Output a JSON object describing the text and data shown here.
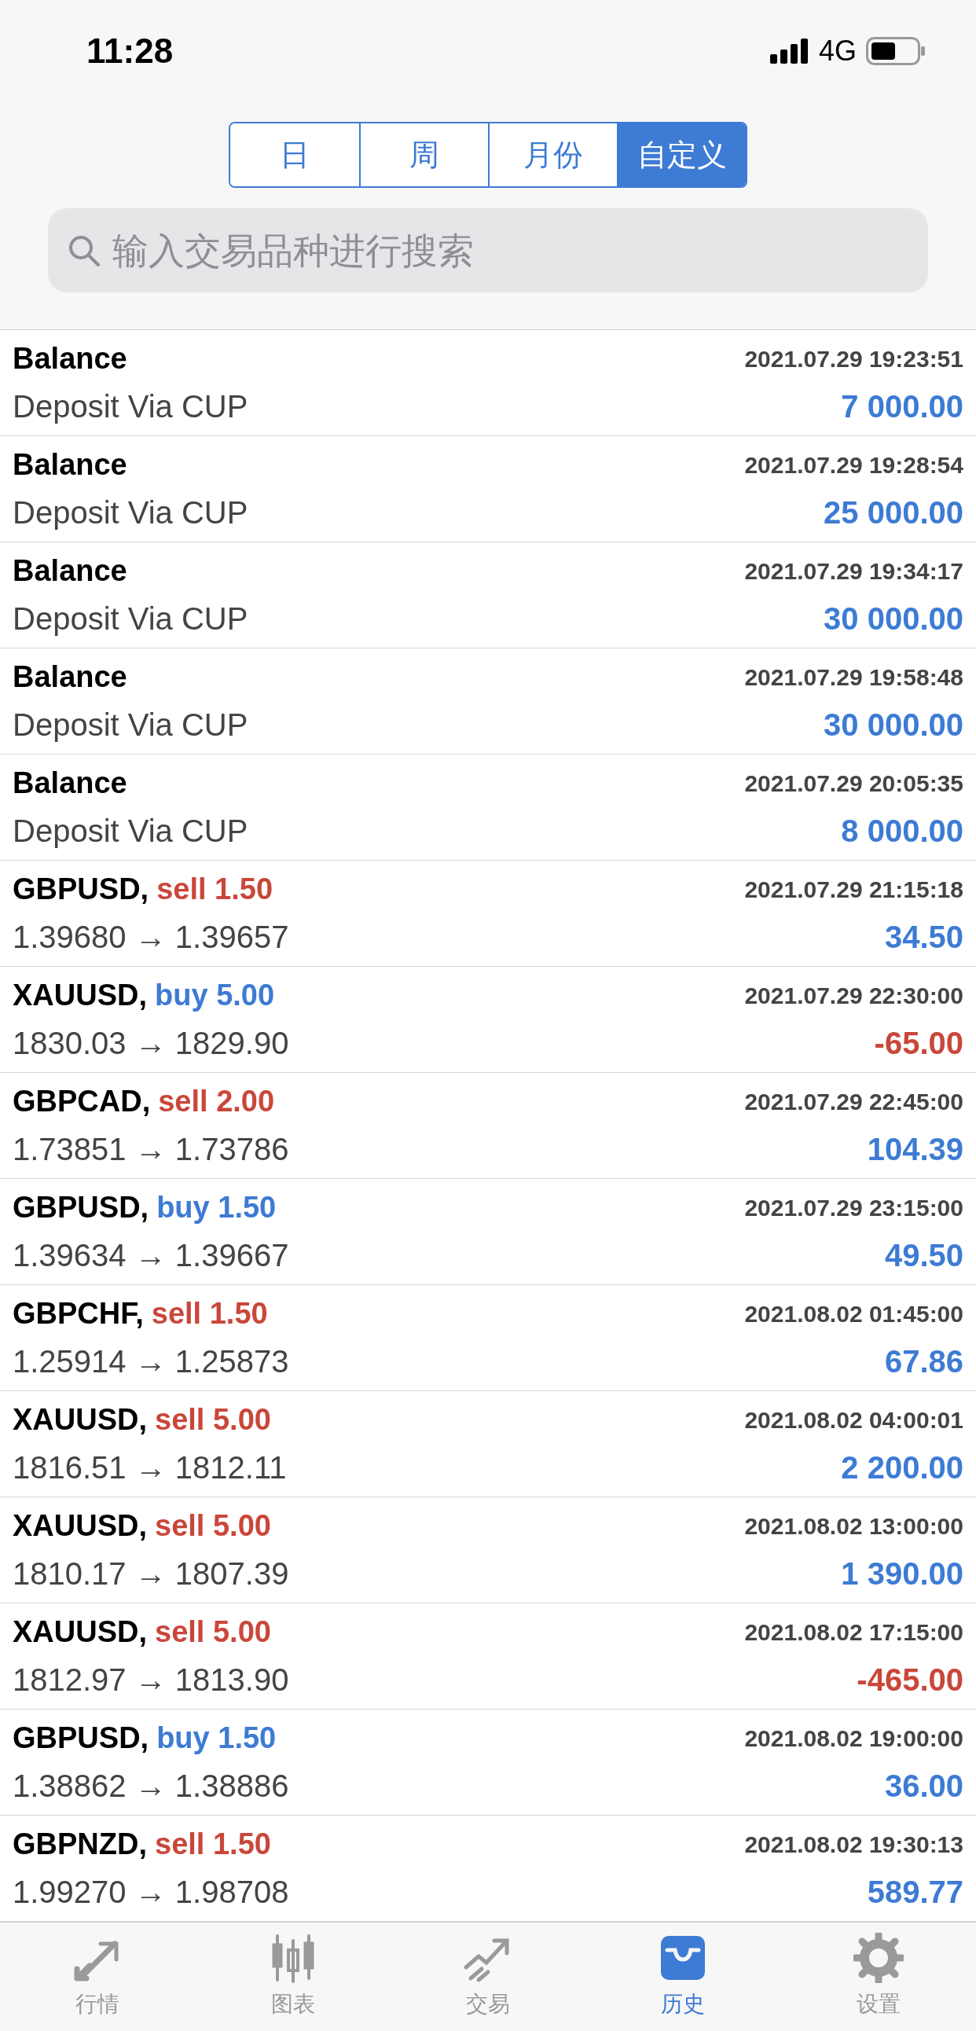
{
  "status_bar": {
    "time": "11:28",
    "network": "4G"
  },
  "periods": [
    {
      "label": "日",
      "selected": false
    },
    {
      "label": "周",
      "selected": false
    },
    {
      "label": "月份",
      "selected": false
    },
    {
      "label": "自定义",
      "selected": true
    }
  ],
  "search": {
    "placeholder": "输入交易品种进行搜索"
  },
  "history": [
    {
      "kind": "balance",
      "title": "Balance",
      "time": "2021.07.29 19:23:51",
      "comment": "Deposit Via CUP",
      "amount": "7 000.00",
      "loss": false
    },
    {
      "kind": "balance",
      "title": "Balance",
      "time": "2021.07.29 19:28:54",
      "comment": "Deposit Via CUP",
      "amount": "25 000.00",
      "loss": false
    },
    {
      "kind": "balance",
      "title": "Balance",
      "time": "2021.07.29 19:34:17",
      "comment": "Deposit Via CUP",
      "amount": "30 000.00",
      "loss": false
    },
    {
      "kind": "balance",
      "title": "Balance",
      "time": "2021.07.29 19:58:48",
      "comment": "Deposit Via CUP",
      "amount": "30 000.00",
      "loss": false
    },
    {
      "kind": "balance",
      "title": "Balance",
      "time": "2021.07.29 20:05:35",
      "comment": "Deposit Via CUP",
      "amount": "8 000.00",
      "loss": false
    },
    {
      "kind": "trade",
      "symbol": "GBPUSD,",
      "color": "#c9473a",
      "order": "sell 1.50",
      "time": "2021.07.29 21:15:18",
      "prices": "1.39680 → 1.39657",
      "amount": "34.50",
      "loss": false
    },
    {
      "kind": "trade",
      "symbol": "XAUUSD,",
      "color": "#3d7bd4",
      "order": "buy 5.00",
      "time": "2021.07.29 22:30:00",
      "prices": "1830.03 → 1829.90",
      "amount": "-65.00",
      "loss": true
    },
    {
      "kind": "trade",
      "symbol": "GBPCAD,",
      "color": "#c9473a",
      "order": "sell 2.00",
      "time": "2021.07.29 22:45:00",
      "prices": "1.73851 → 1.73786",
      "amount": "104.39",
      "loss": false
    },
    {
      "kind": "trade",
      "symbol": "GBPUSD,",
      "color": "#3d7bd4",
      "order": "buy 1.50",
      "time": "2021.07.29 23:15:00",
      "prices": "1.39634 → 1.39667",
      "amount": "49.50",
      "loss": false
    },
    {
      "kind": "trade",
      "symbol": "GBPCHF,",
      "color": "#c9473a",
      "order": "sell 1.50",
      "time": "2021.08.02 01:45:00",
      "prices": "1.25914 → 1.25873",
      "amount": "67.86",
      "loss": false
    },
    {
      "kind": "trade",
      "symbol": "XAUUSD,",
      "color": "#c9473a",
      "order": "sell 5.00",
      "time": "2021.08.02 04:00:01",
      "prices": "1816.51 → 1812.11",
      "amount": "2 200.00",
      "loss": false
    },
    {
      "kind": "trade",
      "symbol": "XAUUSD,",
      "color": "#c9473a",
      "order": "sell 5.00",
      "time": "2021.08.02 13:00:00",
      "prices": "1810.17 → 1807.39",
      "amount": "1 390.00",
      "loss": false
    },
    {
      "kind": "trade",
      "symbol": "XAUUSD,",
      "color": "#c9473a",
      "order": "sell 5.00",
      "time": "2021.08.02 17:15:00",
      "prices": "1812.97 → 1813.90",
      "amount": "-465.00",
      "loss": true
    },
    {
      "kind": "trade",
      "symbol": "GBPUSD,",
      "color": "#3d7bd4",
      "order": "buy 1.50",
      "time": "2021.08.02 19:00:00",
      "prices": "1.38862 → 1.38886",
      "amount": "36.00",
      "loss": false
    },
    {
      "kind": "trade",
      "symbol": "GBPNZD,",
      "color": "#c9473a",
      "order": "sell 1.50",
      "time": "2021.08.02 19:30:13",
      "prices": "1.99270 → 1.98708",
      "amount": "589.77",
      "loss": false
    }
  ],
  "tab_bar": [
    {
      "label": "行情",
      "selected": false
    },
    {
      "label": "图表",
      "selected": false
    },
    {
      "label": "交易",
      "selected": false
    },
    {
      "label": "历史",
      "selected": true
    },
    {
      "label": "设置",
      "selected": false
    }
  ]
}
